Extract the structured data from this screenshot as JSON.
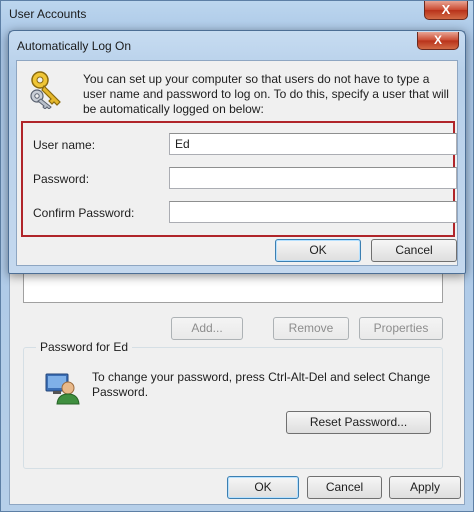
{
  "outer_window": {
    "title": "User Accounts",
    "close_glyph": "X",
    "add_button": "Add...",
    "remove_button": "Remove",
    "properties_button": "Properties",
    "password_group_title": "Password for Ed",
    "password_text": "To change your password, press Ctrl-Alt-Del and select Change Password.",
    "reset_password_button": "Reset Password...",
    "ok_button": "OK",
    "cancel_button": "Cancel",
    "apply_button": "Apply",
    "user_icon": "user-icon"
  },
  "dialog": {
    "title": "Automatically Log On",
    "close_glyph": "X",
    "keys_icon": "keys-icon",
    "intro_text": "You can set up your computer so that users do not have to type a user name and password to log on. To do this, specify a user that will be automatically logged on below:",
    "fields": {
      "user_name_label": "User name:",
      "user_name_value": "Ed",
      "password_label": "Password:",
      "password_value": "",
      "confirm_password_label": "Confirm Password:",
      "confirm_password_value": ""
    },
    "ok_button": "OK",
    "cancel_button": "Cancel"
  },
  "colors": {
    "highlight_border": "#b0252a",
    "title_bar": "#b7d0ea",
    "window_face": "#f0f0f0"
  }
}
